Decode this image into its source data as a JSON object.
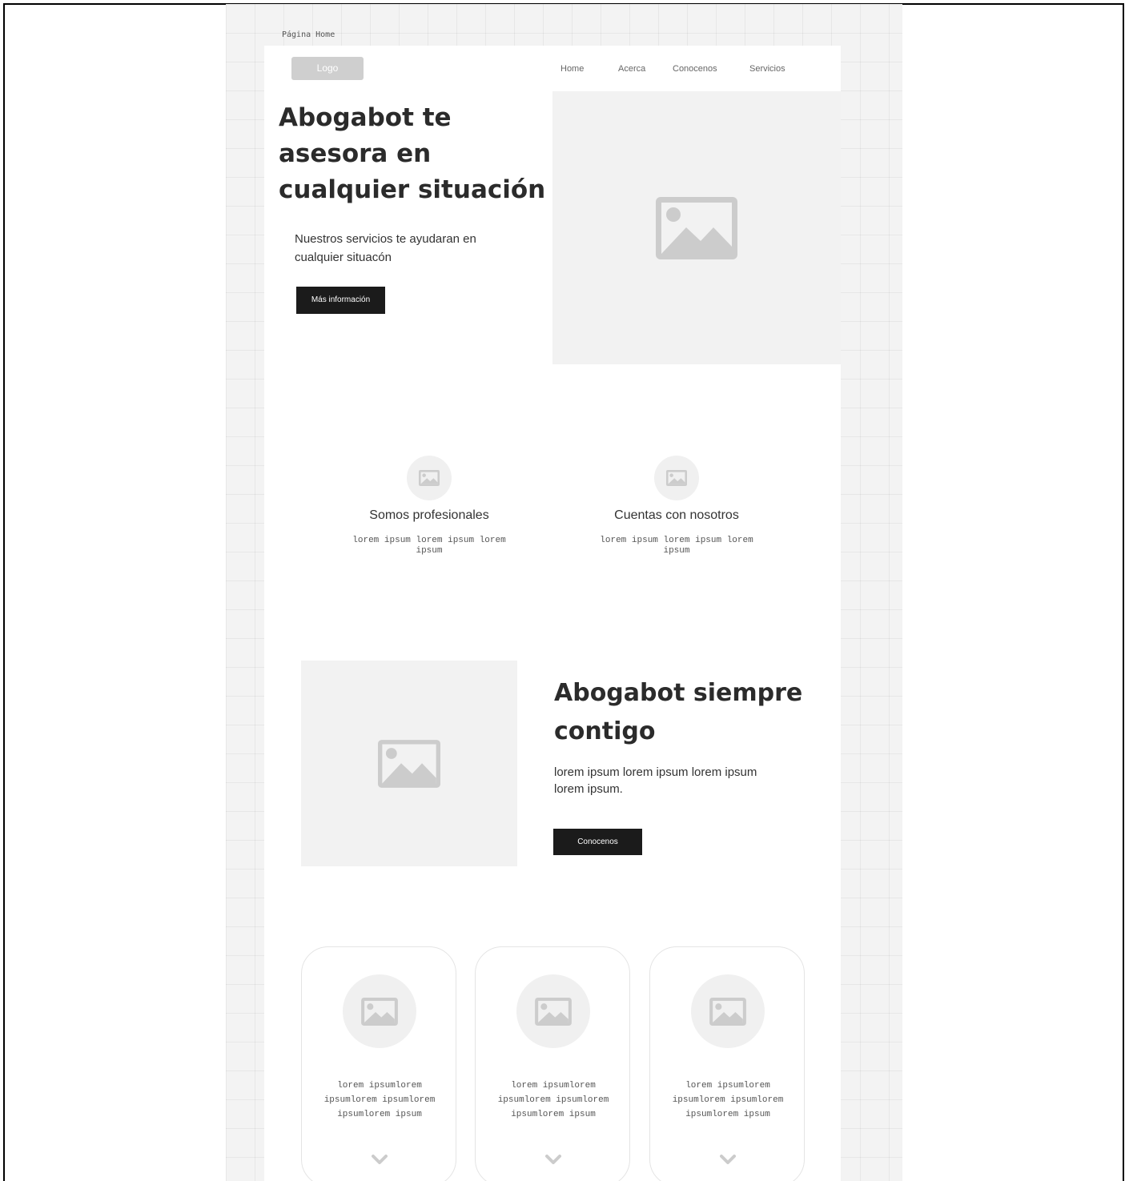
{
  "frame_label": "Página Home",
  "header": {
    "logo": "Logo",
    "nav": [
      "Home",
      "Acerca",
      "Conocenos",
      "Servicios"
    ]
  },
  "hero": {
    "title": "Abogabot te asesora en cualquier situación",
    "subtitle": "Nuestros servicios te ayudaran en cualquier situacón",
    "button": "Más información",
    "image_icon": "image-icon"
  },
  "features": [
    {
      "icon": "image-icon",
      "title": "Somos profesionales",
      "text": "lorem ipsum lorem ipsum lorem ipsum"
    },
    {
      "icon": "image-icon",
      "title": "Cuentas con nosotros",
      "text": "lorem ipsum lorem ipsum lorem ipsum"
    }
  ],
  "section2": {
    "title": "Abogabot siempre contigo",
    "text": "lorem ipsum lorem ipsum lorem ipsum lorem ipsum.",
    "button": "Conocenos",
    "image_icon": "image-icon"
  },
  "cards": [
    {
      "icon": "image-icon",
      "text": "lorem ipsumlorem ipsumlorem ipsumlorem ipsumlorem ipsum",
      "chevron": "chevron-down-icon"
    },
    {
      "icon": "image-icon",
      "text": "lorem ipsumlorem ipsumlorem ipsumlorem ipsumlorem ipsum",
      "chevron": "chevron-down-icon"
    },
    {
      "icon": "image-icon",
      "text": "lorem ipsumlorem ipsumlorem ipsumlorem ipsumlorem ipsum",
      "chevron": "chevron-down-icon"
    }
  ],
  "colors": {
    "canvas": "#f3f3f3",
    "page": "#ffffff",
    "placeholder": "#f2f2f2",
    "icon": "#cccccc",
    "button": "#1b1b1b",
    "logo": "#cfcfcf"
  }
}
